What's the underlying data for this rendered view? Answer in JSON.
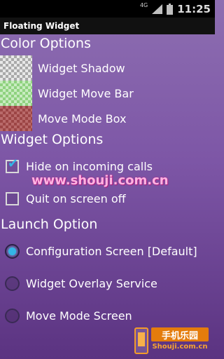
{
  "status_bar": {
    "network": "4G",
    "time": "11:25",
    "icons": [
      "signal-icon",
      "battery-icon"
    ]
  },
  "app": {
    "title": "Floating Widget"
  },
  "color_options": {
    "header": "Color Options",
    "items": [
      {
        "label": "Widget Shadow",
        "swatch_colors": [
          "#e8e8e8",
          "#a9a9a9"
        ]
      },
      {
        "label": "Widget Move Bar",
        "swatch_colors": [
          "#c8ecc0",
          "#8fd27f"
        ]
      },
      {
        "label": "Move Mode Box",
        "swatch_colors": [
          "#b96a6a",
          "#9c4545"
        ]
      }
    ]
  },
  "widget_options": {
    "header": "Widget Options",
    "items": [
      {
        "label": "Hide on incoming calls",
        "checked": true
      },
      {
        "label": "Quit on screen off",
        "checked": false
      }
    ]
  },
  "launch_option": {
    "header": "Launch Option",
    "items": [
      {
        "label": "Configuration Screen [Default]",
        "selected": true
      },
      {
        "label": "Widget Overlay Service",
        "selected": false
      },
      {
        "label": "Move Mode Screen",
        "selected": false
      }
    ]
  },
  "watermark": {
    "url": "www.shouji.com.cn",
    "logo_cn": "手机乐园",
    "logo_en": "Shouji.com.cn"
  },
  "colors": {
    "accent": "#33b5e5",
    "background_top": "#8d6eb1",
    "background_bottom": "#5b3381"
  }
}
